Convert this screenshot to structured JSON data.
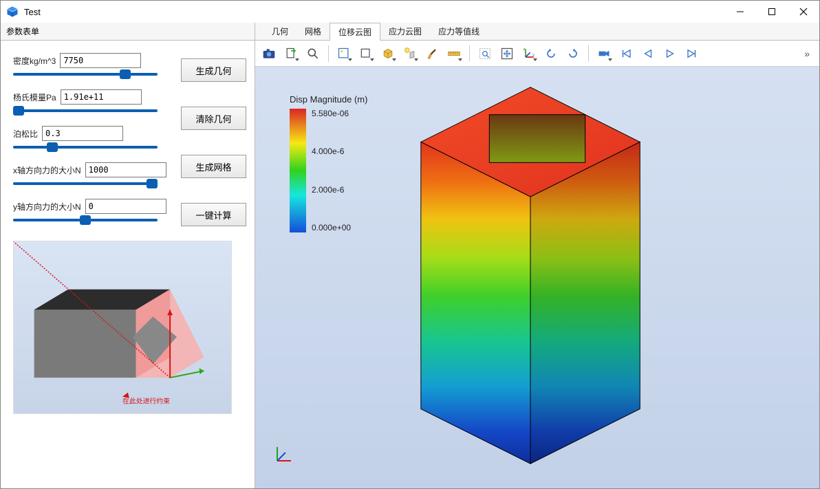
{
  "window": {
    "title": "Test"
  },
  "sidebar": {
    "title": "参数表单",
    "params": {
      "density": {
        "label": "密度kg/m^3",
        "value": "7750"
      },
      "youngs": {
        "label": "杨氏模量Pa",
        "value": "1.91e+11"
      },
      "poisson": {
        "label": "泊松比",
        "value": "0.3"
      },
      "forcex": {
        "label": "x轴方向力的大小N",
        "value": "1000"
      },
      "forcey": {
        "label": "y轴方向力的大小N",
        "value": "0"
      }
    },
    "buttons": {
      "gen_geom": "生成几何",
      "clear_geom": "清除几何",
      "gen_mesh": "生成网格",
      "compute": "一键计算"
    },
    "preview_caption": "在此处进行约束"
  },
  "main": {
    "tabs": [
      "几何",
      "网格",
      "位移云图",
      "应力云图",
      "应力等值线"
    ],
    "active_tab_index": 2,
    "legend": {
      "title": "Disp Magnitude (m)",
      "ticks": [
        "5.580e-06",
        "4.000e-6",
        "2.000e-6",
        "0.000e+00"
      ]
    }
  },
  "chart_data": {
    "type": "heatmap",
    "title": "Disp Magnitude (m)",
    "colormap": "rainbow",
    "range": [
      0.0,
      5.58e-06
    ],
    "ticks": [
      0.0,
      2e-06,
      4e-06,
      5.58e-06
    ],
    "tick_labels": [
      "0.000e+00",
      "2.000e-6",
      "4.000e-6",
      "5.580e-06"
    ],
    "description": "Vertical displacement magnitude on a rectangular prism with a square cutout on the top face; max (red) at top, min (blue) at fixed base."
  }
}
